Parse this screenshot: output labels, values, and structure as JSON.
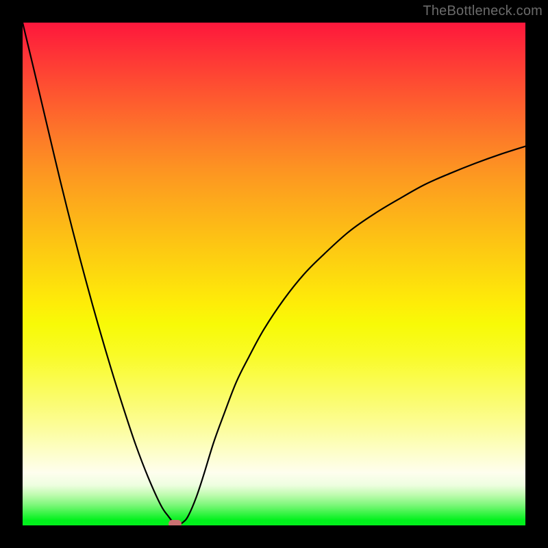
{
  "watermark": "TheBottleneck.com",
  "chart_data": {
    "type": "line",
    "title": "",
    "xlabel": "",
    "ylabel": "",
    "xlim": [
      0,
      100
    ],
    "ylim": [
      0,
      100
    ],
    "grid": false,
    "legend": false,
    "background_gradient": {
      "direction": "vertical",
      "stops": [
        {
          "pos": 0.0,
          "color": "#fe173c"
        },
        {
          "pos": 0.5,
          "color": "#fdd60f"
        },
        {
          "pos": 0.88,
          "color": "#fdfece"
        },
        {
          "pos": 1.0,
          "color": "#02f01d"
        }
      ]
    },
    "series": [
      {
        "name": "bottleneck-curve",
        "x": [
          0.0,
          2.4,
          5.0,
          7.5,
          10.0,
          12.5,
          15.0,
          17.5,
          20.0,
          22.5,
          25.0,
          27.5,
          29.0,
          30.0,
          31.0,
          32.0,
          33.0,
          34.5,
          36.0,
          38.0,
          40.0,
          42.5,
          45.0,
          48.0,
          52.0,
          56.0,
          60.0,
          65.0,
          70.0,
          75.0,
          80.0,
          85.0,
          90.0,
          95.0,
          100.0
        ],
        "y": [
          100.0,
          90.0,
          79.0,
          68.5,
          58.5,
          49.0,
          40.0,
          31.5,
          23.5,
          16.0,
          9.5,
          4.0,
          1.8,
          0.6,
          0.2,
          0.7,
          2.0,
          5.5,
          10.0,
          16.5,
          22.0,
          28.5,
          33.5,
          39.0,
          45.0,
          50.0,
          54.0,
          58.5,
          62.0,
          65.0,
          67.8,
          70.0,
          72.0,
          73.8,
          75.4
        ]
      }
    ],
    "marker": {
      "name": "optimal-point",
      "x": 30.3,
      "y": 0.4,
      "color": "#cb7172",
      "shape": "rounded-rect",
      "width_pct": 2.6,
      "height_pct": 1.5
    }
  }
}
